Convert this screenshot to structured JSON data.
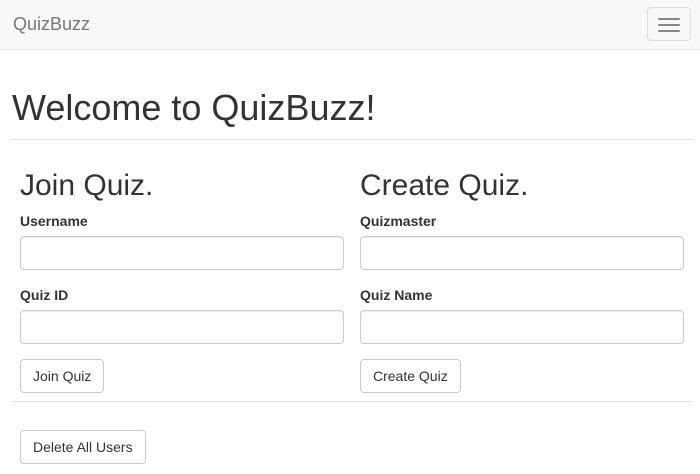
{
  "navbar": {
    "brand": "QuizBuzz",
    "toggle_icon": "hamburger-menu-icon"
  },
  "header": {
    "title": "Welcome to QuizBuzz!"
  },
  "join": {
    "title": "Join Quiz.",
    "username_label": "Username",
    "username_value": "",
    "quiz_id_label": "Quiz ID",
    "quiz_id_value": "",
    "button_label": "Join Quiz"
  },
  "create": {
    "title": "Create Quiz.",
    "quizmaster_label": "Quizmaster",
    "quizmaster_value": "",
    "quiz_name_label": "Quiz Name",
    "quiz_name_value": "",
    "button_label": "Create Quiz"
  },
  "admin": {
    "delete_users_label": "Delete All Users"
  }
}
